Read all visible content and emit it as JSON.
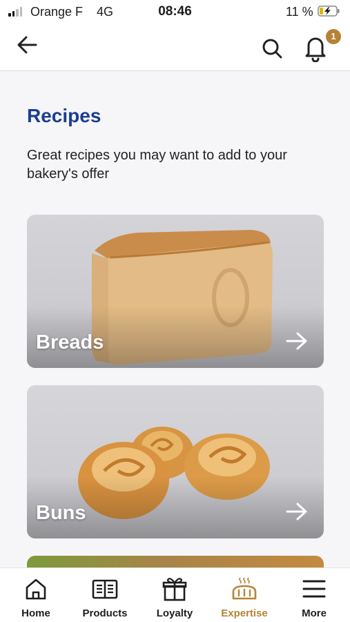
{
  "status_bar": {
    "carrier": "Orange F",
    "network": "4G",
    "time": "08:46",
    "battery_percent": "11 %"
  },
  "header": {
    "back_icon": "arrow-left-icon",
    "search_icon": "search-icon",
    "notifications_icon": "bell-icon",
    "notification_count": "1"
  },
  "page": {
    "title": "Recipes",
    "subtitle": "Great recipes you may want to add to your bakery's offer"
  },
  "cards": [
    {
      "label": "Breads",
      "image": "bread-loaf-photo",
      "arrow_icon": "arrow-right-icon"
    },
    {
      "label": "Buns",
      "image": "buns-photo",
      "arrow_icon": "arrow-right-icon"
    }
  ],
  "bottom_nav": {
    "items": [
      {
        "label": "Home",
        "icon": "home-icon"
      },
      {
        "label": "Products",
        "icon": "book-icon"
      },
      {
        "label": "Loyalty",
        "icon": "gift-icon"
      },
      {
        "label": "Expertise",
        "icon": "bread-icon"
      },
      {
        "label": "More",
        "icon": "menu-icon"
      }
    ],
    "active_index": 3
  },
  "colors": {
    "title_blue": "#1b3f8f",
    "accent_gold": "#b68235",
    "page_background": "#f6f6f9"
  }
}
